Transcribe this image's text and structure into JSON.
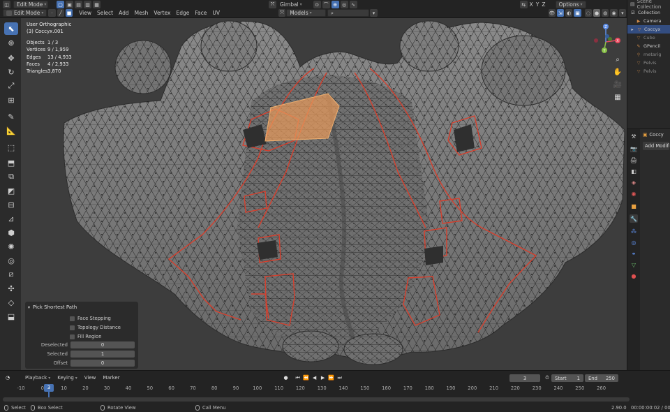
{
  "header": {
    "mode_label": "Edit Mode",
    "menus": [
      "View",
      "Select",
      "Add",
      "Mesh",
      "Vertex",
      "Edge",
      "Face",
      "UV"
    ],
    "orientation_label": "Gimbal",
    "models_label": "Models",
    "axes": [
      "X",
      "Y",
      "Z"
    ],
    "options_label": "Options"
  },
  "viewport": {
    "view_name": "User Orthographic",
    "object_name": "(3) Coccyx.001",
    "stats": [
      {
        "label": "Objects",
        "value": "1 / 3"
      },
      {
        "label": "Vertices",
        "value": "9 / 1,959"
      },
      {
        "label": "Edges",
        "value": "13 / 4,933"
      },
      {
        "label": "Faces",
        "value": "4 / 2,933"
      },
      {
        "label": "Triangles",
        "value": "3,870"
      }
    ],
    "gizmo": {
      "x_label": "X",
      "y_label": "Y",
      "z_label": "Z"
    }
  },
  "operator_panel": {
    "title": "Pick Shortest Path",
    "checkboxes": [
      "Face Stepping",
      "Topology Distance",
      "Fill Region"
    ],
    "fields": [
      {
        "label": "Deselected",
        "value": "0"
      },
      {
        "label": "Selected",
        "value": "1"
      },
      {
        "label": "Offset",
        "value": "0"
      }
    ]
  },
  "outliner": {
    "title": "Scene Collection",
    "items": [
      {
        "label": "Collection",
        "icon": "collection-icon",
        "color": "#e8e8e8"
      },
      {
        "label": "Camera",
        "icon": "camera-icon",
        "color": "#d38d4a"
      },
      {
        "label": "Coccyx",
        "icon": "mesh-icon",
        "color": "#d38d4a"
      },
      {
        "label": "Cube",
        "icon": "mesh-icon",
        "color": "#d38d4a"
      },
      {
        "label": "GPencil",
        "icon": "grease-pencil-icon",
        "color": "#d38d4a"
      },
      {
        "label": "metarig",
        "icon": "armature-icon",
        "color": "#d38d4a"
      },
      {
        "label": "Pelvis",
        "icon": "mesh-icon",
        "color": "#d38d4a"
      },
      {
        "label": "Pelvis",
        "icon": "mesh-icon",
        "color": "#d38d4a"
      }
    ]
  },
  "properties": {
    "object_label": "Coccy",
    "add_modifier_label": "Add Modifier"
  },
  "timeline": {
    "menus": [
      "Playback",
      "Keying",
      "View",
      "Marker"
    ],
    "current_frame": "3",
    "frame_display": "3",
    "start_label": "Start",
    "start_value": "1",
    "end_label": "End",
    "end_value": "250",
    "ruler_ticks": [
      "-10",
      "0",
      "10",
      "20",
      "30",
      "40",
      "50",
      "60",
      "70",
      "80",
      "90",
      "100",
      "110",
      "120",
      "130",
      "140",
      "150",
      "160",
      "170",
      "180",
      "190",
      "200",
      "210",
      "220",
      "230",
      "240",
      "250",
      "260"
    ]
  },
  "status": {
    "select_label": "Select",
    "box_select_label": "Box Select",
    "rotate_label": "Rotate View",
    "call_menu_label": "Call Menu",
    "version": "2.90.0",
    "time": "00:00:00:02 / 00:..."
  },
  "colors": {
    "accent": "#4772b3",
    "selection_edge": "#d6402e",
    "selected_face": "#e89a5c",
    "mesh_gray": "#787878"
  }
}
